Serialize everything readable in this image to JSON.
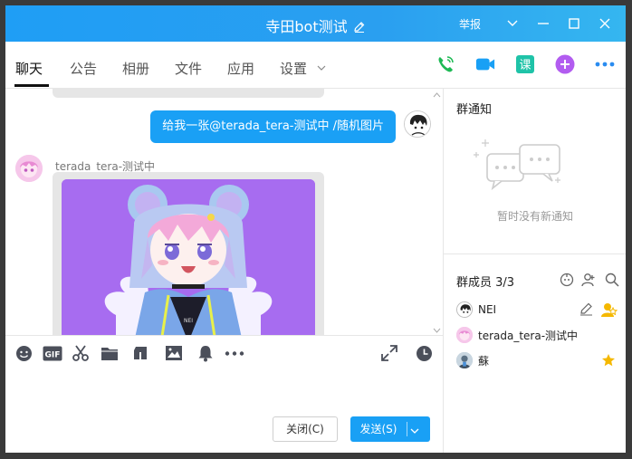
{
  "window": {
    "title": "寺田bot测试",
    "report_label": "举报"
  },
  "tabs": [
    {
      "label": "聊天",
      "active": true
    },
    {
      "label": "公告"
    },
    {
      "label": "相册"
    },
    {
      "label": "文件"
    },
    {
      "label": "应用"
    },
    {
      "label": "设置"
    }
  ],
  "tab_actions": [
    "phone-icon",
    "video-call-icon",
    "class-icon",
    "add-app-icon",
    "more-icon"
  ],
  "tab_actions_labels": {
    "class": "课"
  },
  "chat": {
    "outgoing": {
      "text": "给我一张@terada_tera-测试中 /随机图片"
    },
    "incoming": {
      "sender": "terada_tera-测试中",
      "content": "anime-girl-image"
    }
  },
  "toolbar": [
    "emoji-icon",
    "gif-icon",
    "screenshot-scissors-icon",
    "folder-icon",
    "music-icon",
    "image-icon",
    "bell-icon",
    "more-icon",
    "expand-icon",
    "history-icon"
  ],
  "toolbar_labels": {
    "gif": "GIF"
  },
  "buttons": {
    "close": "关闭(C)",
    "send": "发送(S)"
  },
  "sidebar": {
    "notice_title": "群通知",
    "notice_empty": "暂时没有新通知",
    "members_title": "群成员 3/3",
    "members": [
      {
        "name": "NEI",
        "role": "admin"
      },
      {
        "name": "terada_tera-测试中",
        "role": "member"
      },
      {
        "name": "蘇",
        "role": "owner"
      }
    ]
  },
  "colors": {
    "accent": "#1aa0f5",
    "image_bg": "#a76cf0",
    "phone": "#1db954",
    "video": "#19a0f5",
    "class": "#1fc3a8",
    "add": "#b25cf0",
    "star": "#f5b800"
  }
}
